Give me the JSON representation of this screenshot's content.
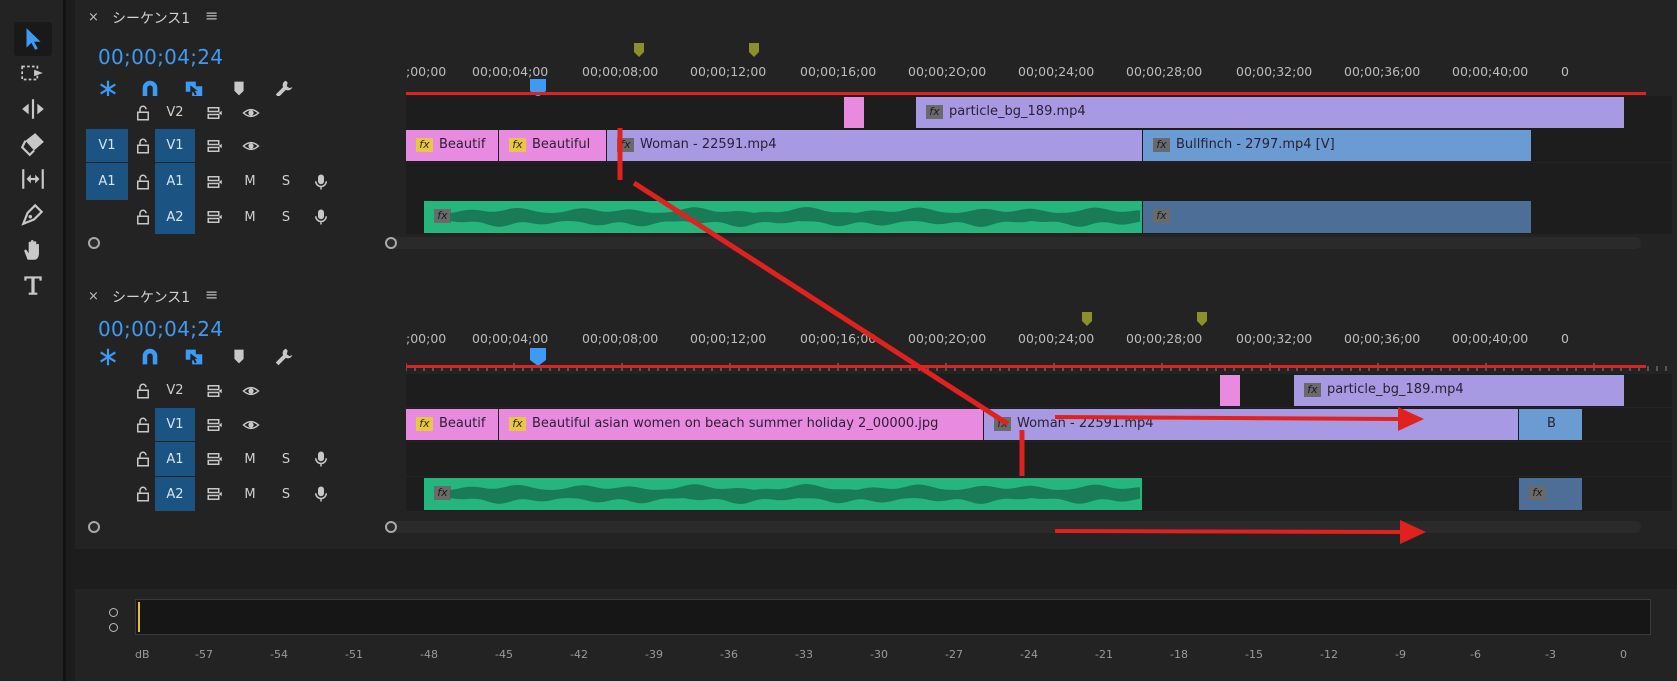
{
  "tools": [
    "selection-tool",
    "track-select-forward-tool",
    "ripple-edit-tool",
    "razor-tool",
    "slip-tool",
    "pen-tool",
    "hand-tool",
    "type-tool"
  ],
  "sequence_name": "シーケンス1",
  "close_glyph": "×",
  "menu_glyph": "≡",
  "timecode": "00;00;04;24",
  "ruler_labels": [
    ";00;00",
    "00;00;04;00",
    "00;00;08;00",
    "00;00;12;00",
    "00;00;16;00",
    "00;00;2O;00",
    "00;00;24;00",
    "00;00;28;00",
    "00;00;32;00",
    "00;00;36;00",
    "00;00;40;00",
    "0"
  ],
  "track_labels": {
    "v1": "V1",
    "v2": "V2",
    "a1": "A1",
    "a2": "A2",
    "mute": "M",
    "solo": "S"
  },
  "top": {
    "clips_v2": [
      "particle_bg_189.mp4"
    ],
    "clips_v1": [
      "Beautif",
      "Beautiful",
      "Woman - 22591.mp4",
      "Bullfinch - 2797.mp4 [V]"
    ]
  },
  "bottom": {
    "clips_v2": [
      "particle_bg_189.mp4"
    ],
    "clips_v1": [
      "Beautif",
      "Beautiful asian women on beach summer holiday 2_00000.jpg",
      "Woman - 22591.mp4",
      "B"
    ]
  },
  "meters": {
    "unit": "dB",
    "scale": [
      "-57",
      "-54",
      "-51",
      "-48",
      "-45",
      "-42",
      "-39",
      "-36",
      "-33",
      "-30",
      "-27",
      "-24",
      "-21",
      "-18",
      "-15",
      "-12",
      "-9",
      "-6",
      "-3",
      "0"
    ]
  },
  "colors": {
    "accent": "#3d9bf3",
    "annotation": "#e0221f",
    "clip_pink": "#e88ae0",
    "clip_purple": "#a799e2",
    "clip_blue": "#6b9bd3",
    "audio_green": "#27b57e"
  }
}
